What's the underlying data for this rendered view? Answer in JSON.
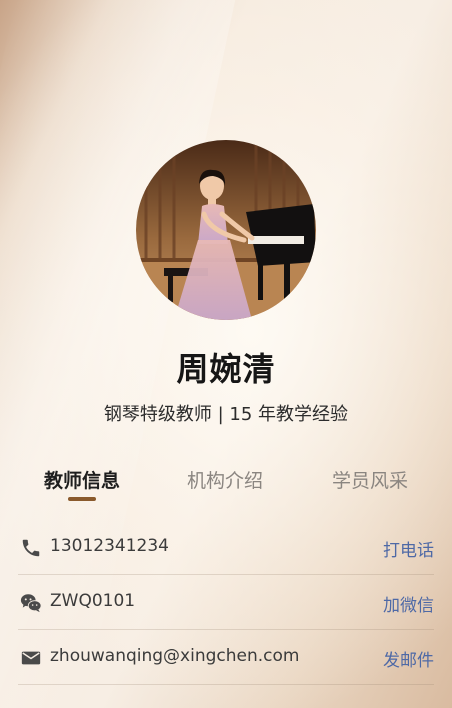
{
  "profile": {
    "name": "周婉清",
    "subtitle": "钢琴特级教师 | 15 年教学经验",
    "avatar_icon": "teacher-at-piano-photo"
  },
  "tabs": [
    {
      "label": "教师信息",
      "active": true
    },
    {
      "label": "机构介绍",
      "active": false
    },
    {
      "label": "学员风采",
      "active": false
    }
  ],
  "contacts": {
    "phone": {
      "icon": "phone-icon",
      "value": "13012341234",
      "action": "打电话"
    },
    "wechat": {
      "icon": "wechat-icon",
      "value": "ZWQ0101",
      "action": "加微信"
    },
    "email": {
      "icon": "mail-icon",
      "value": "zhouwanqing@xingchen.com",
      "action": "发邮件"
    }
  },
  "colors": {
    "accent": "#8a5a2c",
    "link": "#4e69a6",
    "title": "#161616"
  }
}
